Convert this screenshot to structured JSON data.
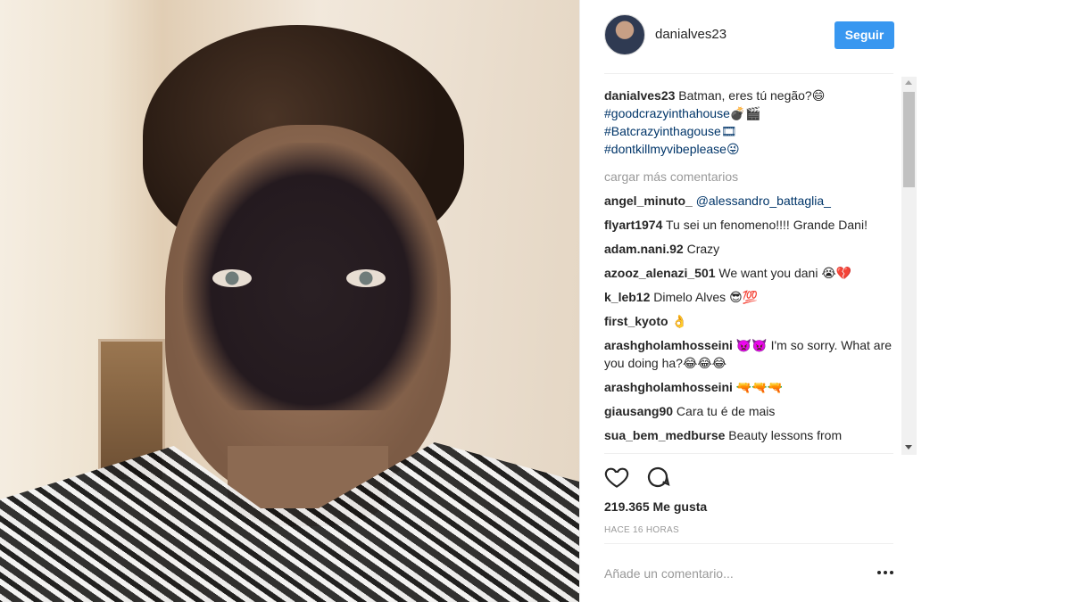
{
  "post": {
    "username": "danialves23",
    "follow_label": "Seguir",
    "caption_text": " Batman, eres tú negão?😄",
    "hashtags": [
      "#goodcrazyinthahouse💣🎬",
      "#Batcrazyinthagouse🎞",
      "#dontkillmyvibeplease😜"
    ],
    "load_more": "cargar más comentarios",
    "comments": [
      {
        "user": "angel_minuto_",
        "text": " ",
        "mention": "@alessandro_battaglia_"
      },
      {
        "user": "flyart1974",
        "text": " Tu sei un fenomeno!!!! Grande Dani!"
      },
      {
        "user": "adam.nani.92",
        "text": " Crazy"
      },
      {
        "user": "azooz_alenazi_501",
        "text": " We want you dani 😭💔"
      },
      {
        "user": "k_leb12",
        "text": " Dimelo Alves 😎💯"
      },
      {
        "user": "first_kyoto",
        "text": " 👌"
      },
      {
        "user": "arashgholamhosseini",
        "text": " 👿👿 I'm so sorry. What are you doing ha?😂😂😂"
      },
      {
        "user": "arashgholamhosseini",
        "text": " 🔫🔫🔫"
      },
      {
        "user": "giausang90",
        "text": " Cara tu é de mais"
      },
      {
        "user": "sua_bem_medburse",
        "text": " Beauty lessons from"
      }
    ],
    "likes": "219.365 Me gusta",
    "timestamp": "HACE 16 HORAS",
    "add_comment_placeholder": "Añade un comentario...",
    "icons": {
      "like": "heart-outline-icon",
      "comment": "speech-bubble-icon",
      "more": "more-options-icon"
    },
    "colors": {
      "accent": "#3897f0",
      "hashtag": "#003569",
      "muted": "#999999"
    }
  }
}
